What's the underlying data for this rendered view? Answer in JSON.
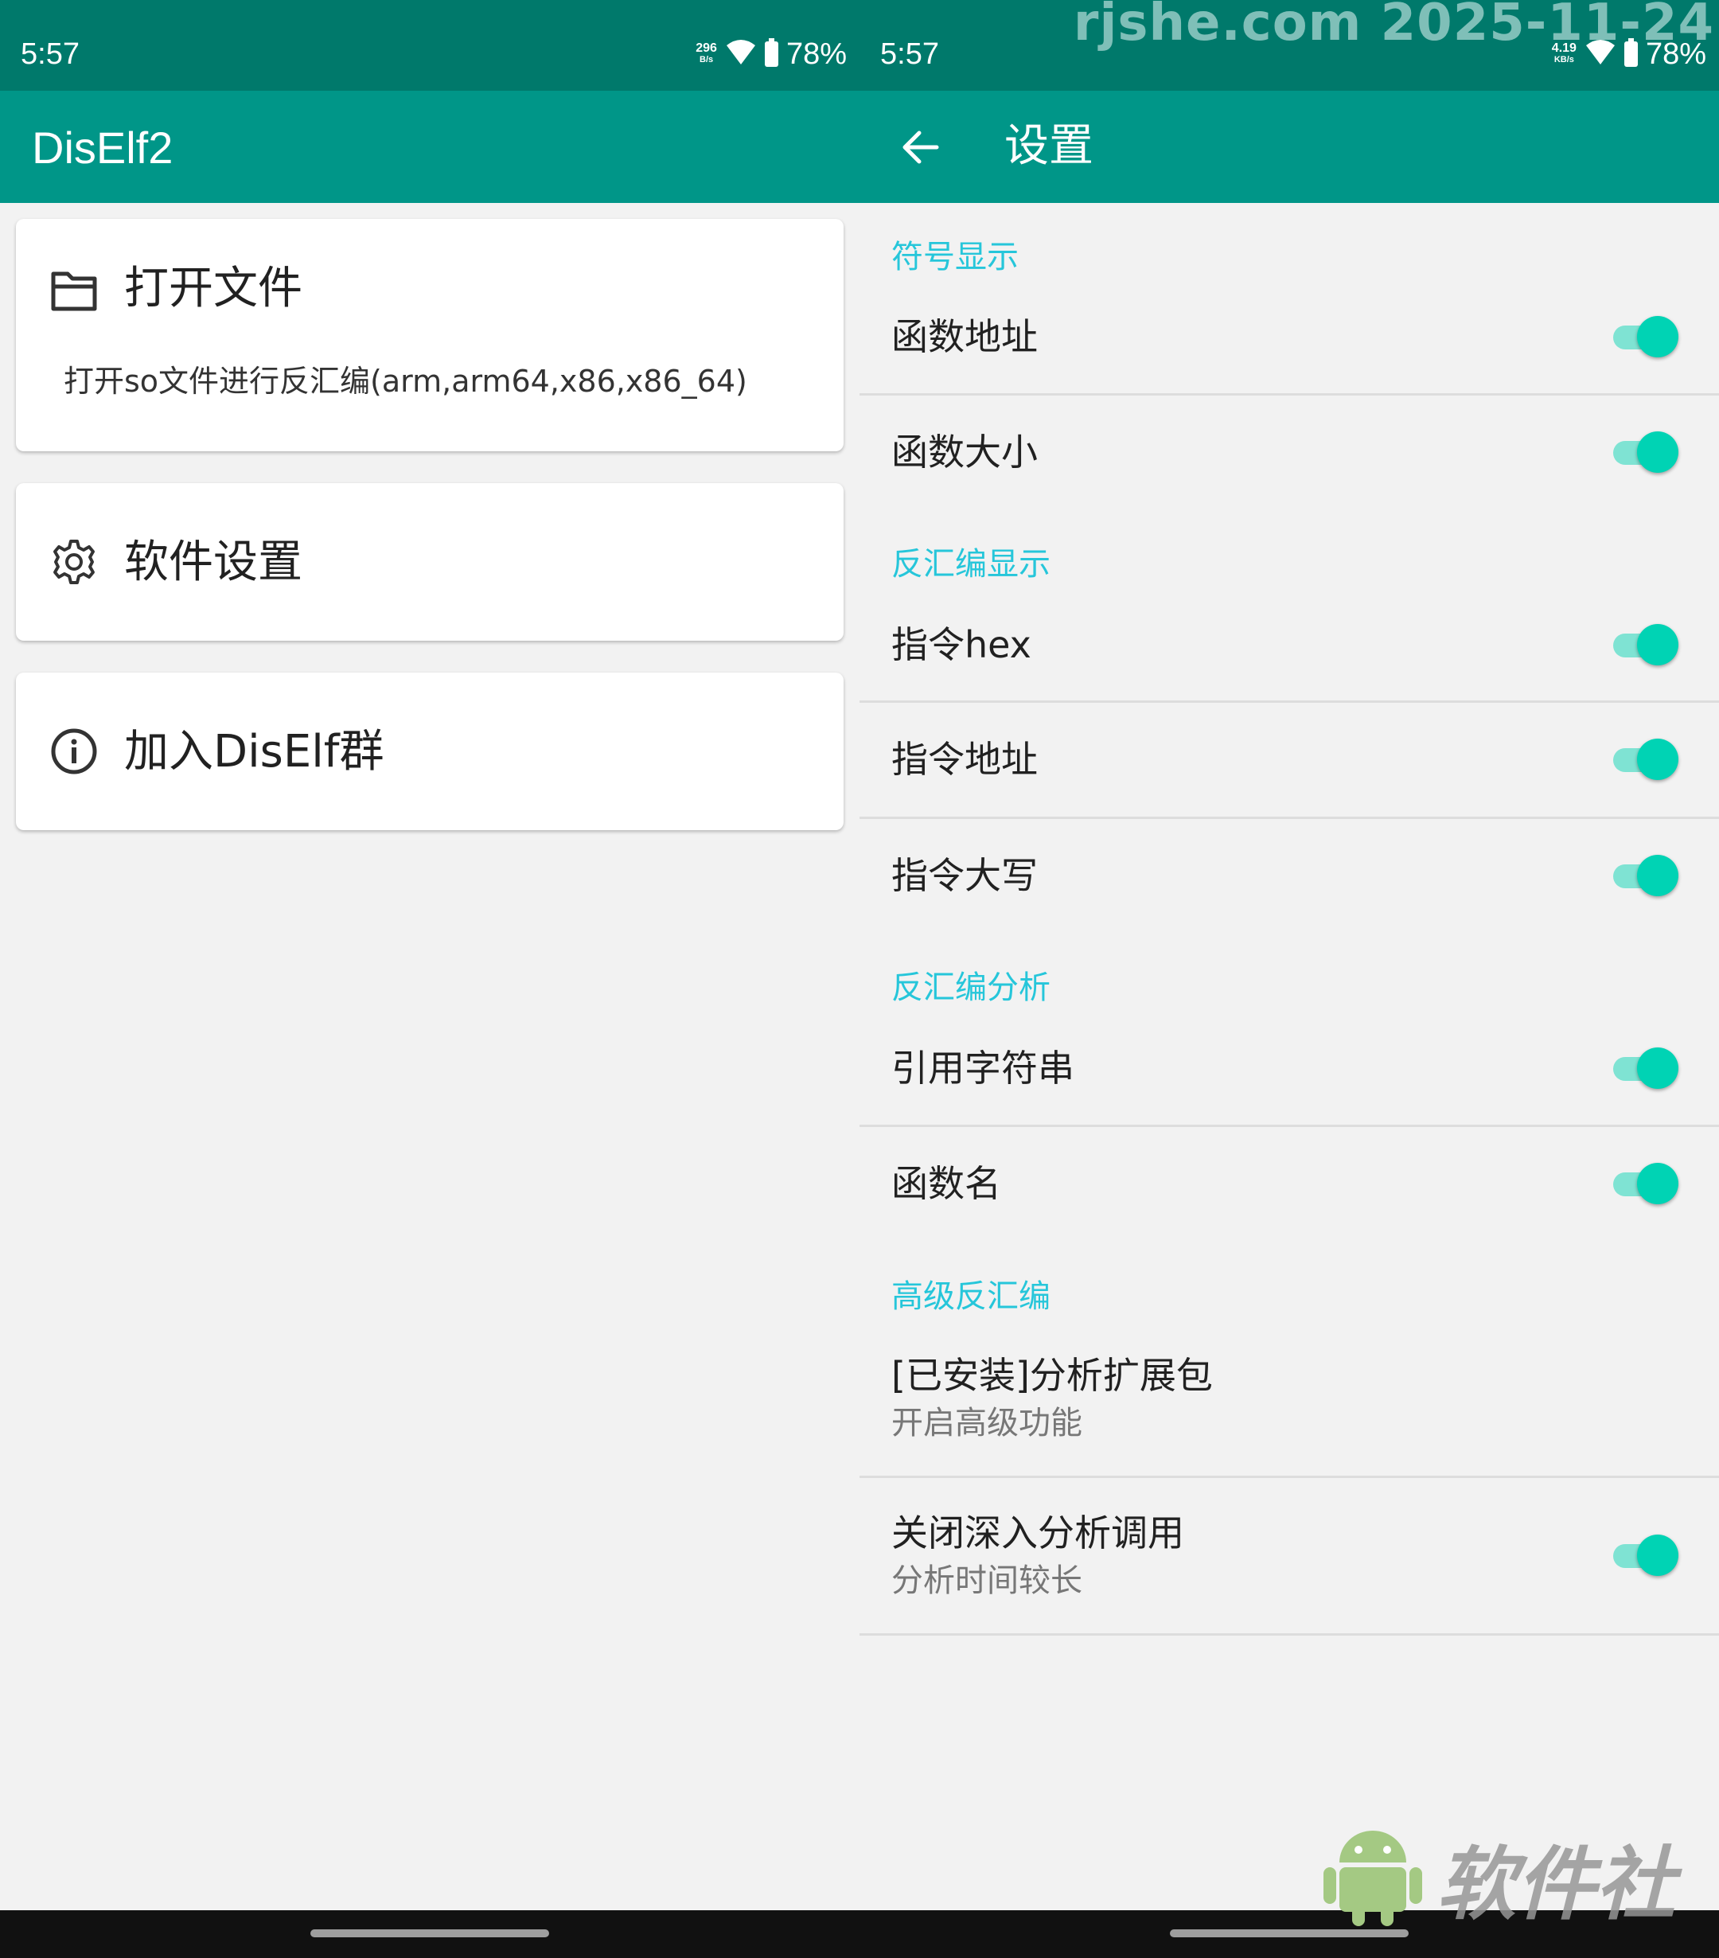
{
  "status_bar_left": {
    "time": "5:57",
    "net_speed_value": "296",
    "net_speed_unit": "B/s",
    "battery": "78%"
  },
  "status_bar_right": {
    "time": "5:57",
    "net_speed_value": "4.19",
    "net_speed_unit": "KB/s",
    "battery": "78%"
  },
  "home": {
    "title": "DisElf2",
    "cards": [
      {
        "label": "打开文件",
        "desc": "打开so文件进行反汇编(arm,arm64,x86,x86_64)",
        "icon": "folder-icon"
      },
      {
        "label": "软件设置",
        "icon": "gear-icon"
      },
      {
        "label": "加入DisElf群",
        "icon": "info-icon"
      }
    ]
  },
  "settings": {
    "title": "设置",
    "categories": {
      "symbol": "符号显示",
      "disasm_display": "反汇编显示",
      "disasm_analysis": "反汇编分析",
      "advanced": "高级反汇编"
    },
    "items": {
      "func_addr": {
        "title": "函数地址",
        "on": true
      },
      "func_size": {
        "title": "函数大小",
        "on": true
      },
      "inst_hex": {
        "title": "指令hex",
        "on": true
      },
      "inst_addr": {
        "title": "指令地址",
        "on": true
      },
      "inst_upper": {
        "title": "指令大写",
        "on": true
      },
      "ref_string": {
        "title": "引用字符串",
        "on": true
      },
      "func_name": {
        "title": "函数名",
        "on": true
      },
      "ext_pack": {
        "title": "[已安装]分析扩展包",
        "subtitle": "开启高级功能"
      },
      "deep_analysis": {
        "title": "关闭深入分析调用",
        "subtitle": "分析时间较长",
        "on": true
      }
    }
  },
  "watermarks": {
    "top": "rjshe.com 2025-11-24",
    "bottom": "软件社"
  },
  "colors": {
    "status_bar": "#00796b",
    "app_bar": "#009688",
    "accent": "#26c6da",
    "switch_thumb": "#00d3b4"
  }
}
